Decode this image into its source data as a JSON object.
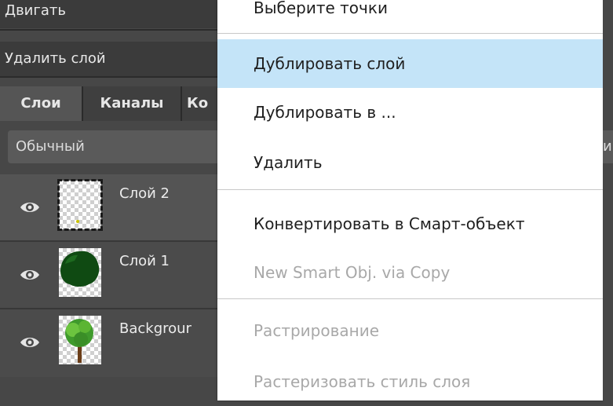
{
  "panel": {
    "menu_items": [
      {
        "label": "Двигать"
      },
      {
        "label": "Удалить слой"
      }
    ],
    "tabs": [
      {
        "label": "Слои",
        "active": true
      },
      {
        "label": "Каналы",
        "active": false
      },
      {
        "label": "Ко",
        "active": false
      }
    ],
    "blend_mode": "Обычный",
    "layers": [
      {
        "name": "Слой 2",
        "selected": true
      },
      {
        "name": "Слой 1",
        "selected": false
      },
      {
        "name": "Backgrour",
        "selected": false
      }
    ],
    "visibility_icon": "eye-icon"
  },
  "context_menu": {
    "items": [
      {
        "label": "Выберите точки",
        "state": "normal"
      },
      {
        "label": "Дублировать слой",
        "state": "hover"
      },
      {
        "label": "Дублировать в ...",
        "state": "normal"
      },
      {
        "label": "Удалить",
        "state": "normal"
      },
      {
        "label": "Конвертировать в Смарт-объект",
        "state": "normal"
      },
      {
        "label": "New Smart Obj. via Copy",
        "state": "disabled"
      },
      {
        "label": "Растрирование",
        "state": "disabled"
      },
      {
        "label": "Растеризовать стиль слоя",
        "state": "disabled"
      }
    ]
  },
  "right_peek_text": "им",
  "colors": {
    "panel_bg": "#474747",
    "menu_hover": "#c4e4f8",
    "disabled_text": "#a8a8a8"
  }
}
